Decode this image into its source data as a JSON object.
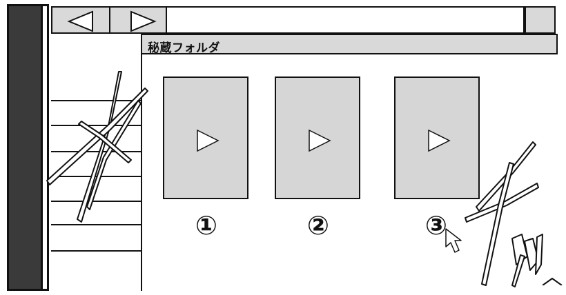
{
  "toolbar": {
    "back_icon": "back-arrow-icon",
    "forward_icon": "forward-arrow-icon",
    "address_value": ""
  },
  "folder": {
    "title": "秘蔵フォルダ"
  },
  "videos": [
    {
      "number": "①",
      "icon": "play-icon"
    },
    {
      "number": "②",
      "icon": "play-icon"
    },
    {
      "number": "③",
      "icon": "play-icon"
    }
  ],
  "colors": {
    "toolbar_bg": "#d9d9d9",
    "thumb_bg": "#d6d6d6",
    "bezel": "#3a3a3a",
    "outline": "#111111"
  }
}
